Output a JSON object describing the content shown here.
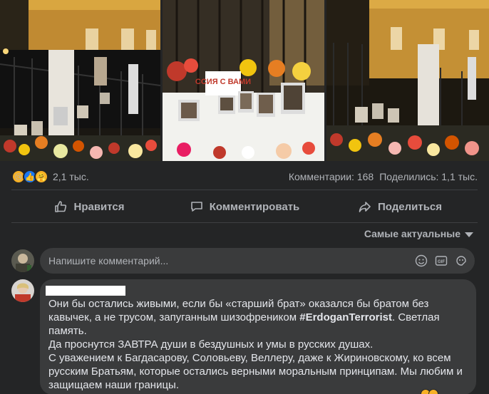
{
  "post": {
    "reactions": {
      "icons": [
        "sad-reaction",
        "like-reaction",
        "care-reaction"
      ],
      "count": "2,1 тыс."
    },
    "comments_count": "Комментарии: 168",
    "shares_count": "Поделились: 1,1 тыс."
  },
  "actions": {
    "like": "Нравится",
    "comment": "Комментировать",
    "share": "Поделиться"
  },
  "sort_label": "Самые актуальные",
  "composer": {
    "placeholder": "Напишите комментарий..."
  },
  "photo_banner": "ССИЯ С ВАМИ",
  "comment": {
    "line1": "Они бы остались живыми, если бы «старший брат» оказался бы братом без кавычек, а не трусом, запуганным шизофреником ",
    "hashtag": "#ErdoganTerrorist",
    "line1_end": ". Светлая память.",
    "line2": "Да проснутся ЗАВТРА души в бездушных и умы в русских душах.",
    "line3": "С уважением к Багдасарову, Соловьеву, Веллеру, даже к Жириновскому, ко всем русским Братьям, которые остались верными моральным принципам. Мы любим и защищаем наши границы."
  },
  "colors": {
    "background": "#242526",
    "bubble": "#3a3b3c",
    "text": "#e4e6eb",
    "secondary_text": "#b0b3b8",
    "like_blue": "#1877f2"
  }
}
